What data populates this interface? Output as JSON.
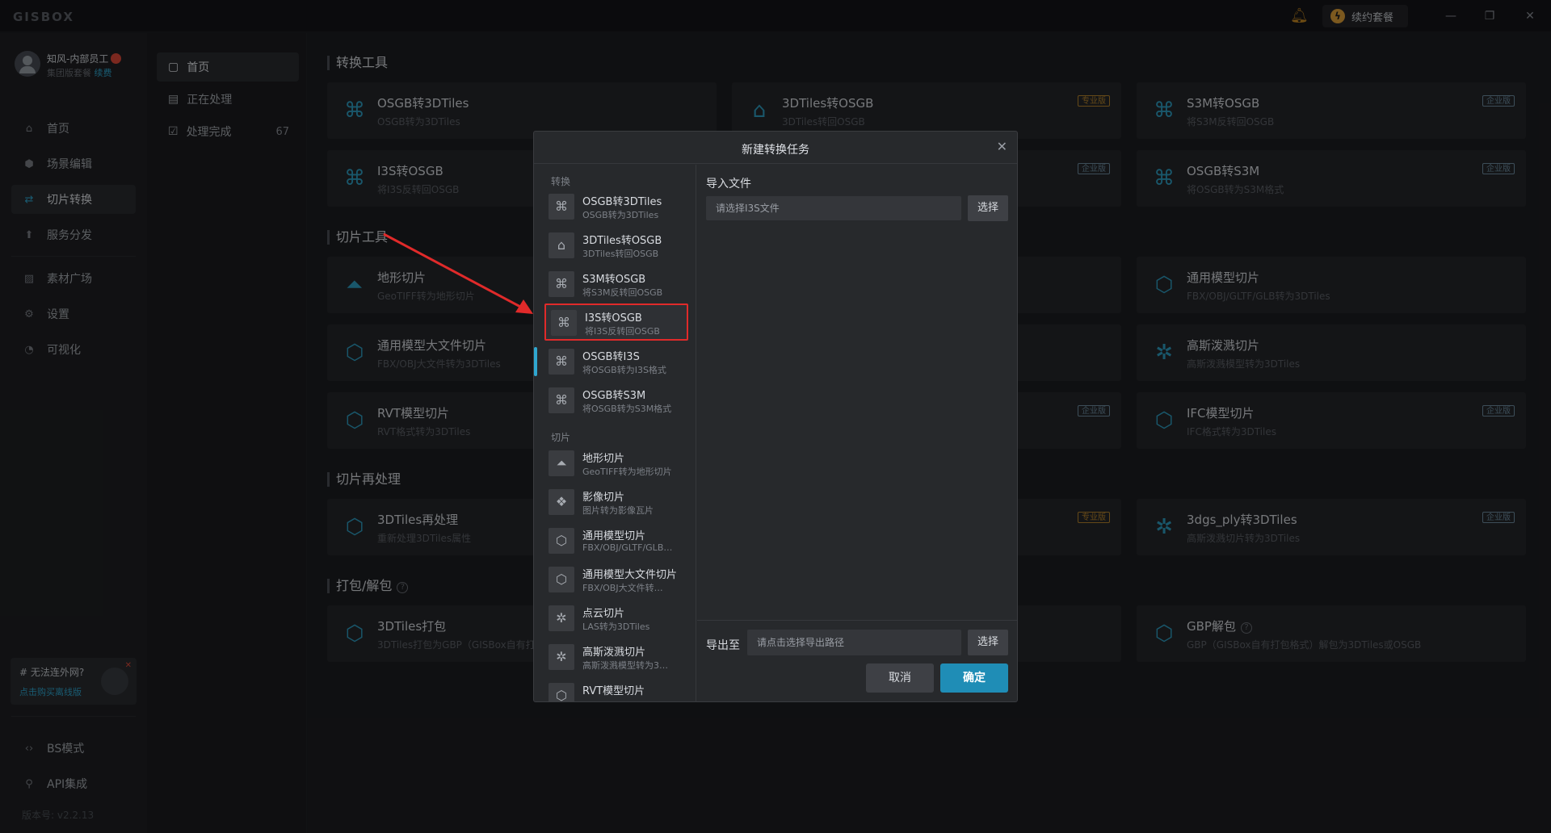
{
  "app": {
    "logo": "GISBOX",
    "renew_label": "续约套餐"
  },
  "user": {
    "name": "知风-内部员工",
    "plan": "集团版套餐",
    "renew": "续费"
  },
  "leftnav": [
    {
      "label": "首页",
      "icon": "home-icon"
    },
    {
      "label": "场景编辑",
      "icon": "cube-icon"
    },
    {
      "label": "切片转换",
      "icon": "convert-icon"
    },
    {
      "label": "服务分发",
      "icon": "upload-icon"
    },
    {
      "label": "素材广场",
      "icon": "image-icon"
    },
    {
      "label": "设置",
      "icon": "gear-icon"
    },
    {
      "label": "可视化",
      "icon": "chart-icon"
    }
  ],
  "promo": {
    "title": "# 无法连外网?",
    "link": "点击购买离线版"
  },
  "bottomnav": [
    {
      "label": "BS模式",
      "icon": "code-icon"
    },
    {
      "label": "API集成",
      "icon": "api-icon"
    }
  ],
  "version": "版本号: v2.2.13",
  "subnav": [
    {
      "label": "首页"
    },
    {
      "label": "正在处理"
    },
    {
      "label": "处理完成",
      "count": "67"
    }
  ],
  "sections": {
    "convert": "转换工具",
    "slice": "切片工具",
    "reprocess": "切片再处理",
    "pack": "打包/解包"
  },
  "cards": {
    "c1": {
      "title": "OSGB转3DTiles",
      "desc": "OSGB转为3DTiles"
    },
    "c2": {
      "title": "3DTiles转OSGB",
      "desc": "3DTiles转回OSGB",
      "badge": "专业版"
    },
    "c3": {
      "title": "S3M转OSGB",
      "desc": "将S3M反转回OSGB",
      "badge": "企业版"
    },
    "c4": {
      "title": "I3S转OSGB",
      "desc": "将I3S反转回OSGB"
    },
    "c5": {
      "title": "OSGB转S3M",
      "desc": "将OSGB转为S3M格式",
      "badge": "企业版"
    },
    "c6": {
      "title": "地形切片",
      "desc": "GeoTIFF转为地形切片"
    },
    "c7": {
      "title": "通用模型切片",
      "desc": "FBX/OBJ/GLTF/GLB转为3DTiles"
    },
    "c8": {
      "title": "通用模型大文件切片",
      "desc": "FBX/OBJ大文件转为3DTiles"
    },
    "c9": {
      "title": "高斯泼溅切片",
      "desc": "高斯泼溅模型转为3DTiles"
    },
    "c10": {
      "title": "RVT模型切片",
      "desc": "RVT格式转为3DTiles"
    },
    "c11": {
      "title": "IFC模型切片",
      "desc": "IFC格式转为3DTiles",
      "badge": "企业版"
    },
    "c12": {
      "title": "3DTiles再处理",
      "desc": "重新处理3DTiles属性"
    },
    "c13": {
      "title": "3dgs_ply转3DTiles",
      "desc": "高斯泼溅切片转为3DTiles",
      "badge": "企业版"
    },
    "c14": {
      "title": "3DTiles打包",
      "desc": "3DTiles打包为GBP（GISBox自有打"
    },
    "c15": {
      "title": "GBP解包",
      "desc": "GBP（GISBox自有打包格式）解包为3DTiles或OSGB"
    },
    "b_pro": "专业版",
    "b_ent": "企业版"
  },
  "dialog": {
    "title": "新建转换任务",
    "group_convert": "转换",
    "group_slice": "切片",
    "items": [
      {
        "title": "OSGB转3DTiles",
        "desc": "OSGB转为3DTiles"
      },
      {
        "title": "3DTiles转OSGB",
        "desc": "3DTiles转回OSGB"
      },
      {
        "title": "S3M转OSGB",
        "desc": "将S3M反转回OSGB"
      },
      {
        "title": "I3S转OSGB",
        "desc": "将I3S反转回OSGB"
      },
      {
        "title": "OSGB转I3S",
        "desc": "将OSGB转为I3S格式"
      },
      {
        "title": "OSGB转S3M",
        "desc": "将OSGB转为S3M格式"
      },
      {
        "title": "地形切片",
        "desc": "GeoTIFF转为地形切片"
      },
      {
        "title": "影像切片",
        "desc": "图片转为影像瓦片"
      },
      {
        "title": "通用模型切片",
        "desc": "FBX/OBJ/GLTF/GLB…"
      },
      {
        "title": "通用模型大文件切片",
        "desc": "FBX/OBJ大文件转…"
      },
      {
        "title": "点云切片",
        "desc": "LAS转为3DTiles"
      },
      {
        "title": "高斯泼溅切片",
        "desc": "高斯泼溅模型转为3…"
      },
      {
        "title": "RVT模型切片",
        "desc": ""
      }
    ],
    "import_label": "导入文件",
    "import_placeholder": "请选择I3S文件",
    "choose": "选择",
    "export_label": "导出至",
    "export_placeholder": "请点击选择导出路径",
    "cancel": "取消",
    "confirm": "确定"
  }
}
